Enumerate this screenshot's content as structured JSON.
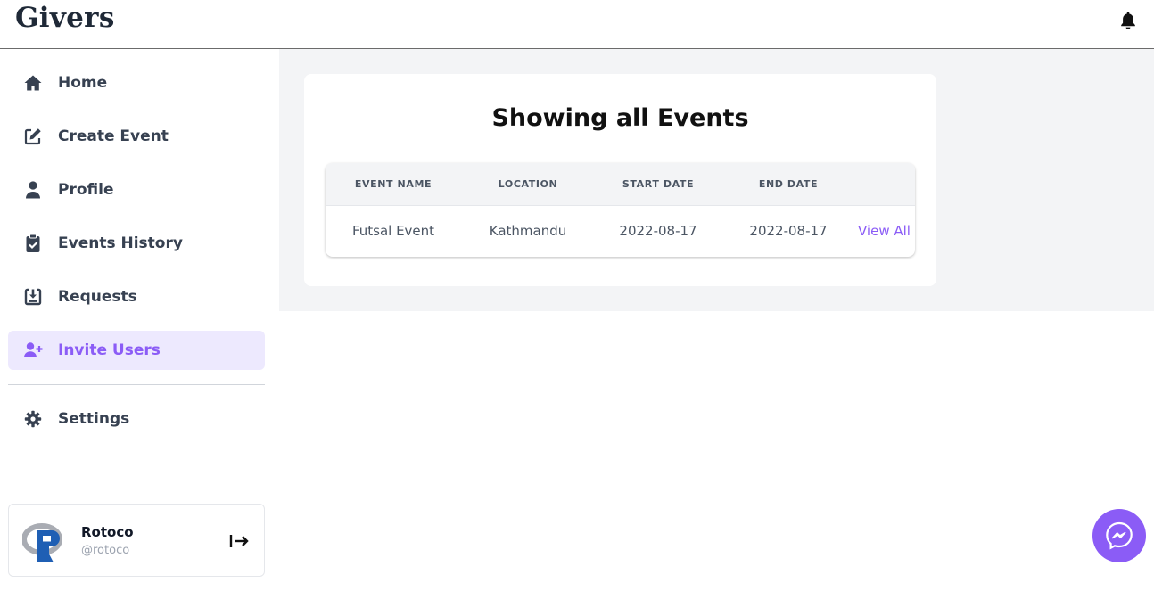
{
  "app": {
    "title": "Givers"
  },
  "colors": {
    "accent": "#8b5cf6",
    "accent_bg": "#ede9fe",
    "main_bg": "#f3f4f6"
  },
  "sidebar": {
    "items": [
      {
        "label": "Home",
        "icon": "home-icon"
      },
      {
        "label": "Create Event",
        "icon": "edit-icon"
      },
      {
        "label": "Profile",
        "icon": "user-icon"
      },
      {
        "label": "Events History",
        "icon": "clipboard-check-icon"
      },
      {
        "label": "Requests",
        "icon": "download-box-icon"
      },
      {
        "label": "Invite Users",
        "icon": "user-plus-icon",
        "active": true
      }
    ],
    "settings": {
      "label": "Settings",
      "icon": "gear-icon"
    }
  },
  "user": {
    "name": "Rotoco",
    "handle": "@rotoco"
  },
  "main": {
    "title": "Showing all Events",
    "table": {
      "headers": [
        "EVENT NAME",
        "LOCATION",
        "START DATE",
        "END DATE"
      ],
      "rows": [
        {
          "event_name": "Futsal Event",
          "location": "Kathmandu",
          "start_date": "2022-08-17",
          "end_date": "2022-08-17",
          "action": "View All"
        }
      ]
    }
  }
}
